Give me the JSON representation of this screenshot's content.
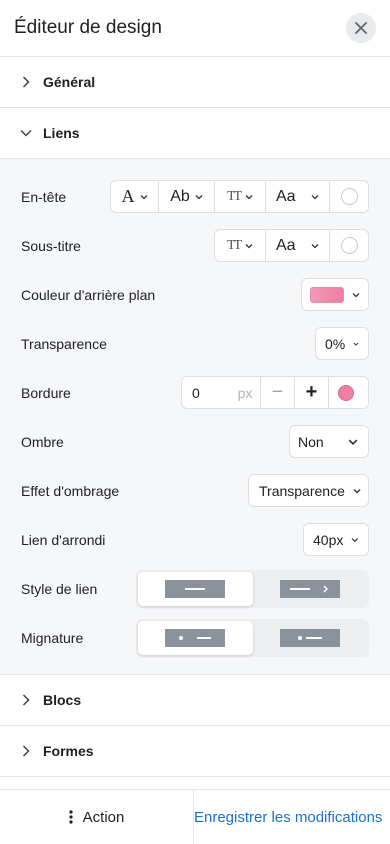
{
  "header": {
    "title": "Éditeur de design",
    "close_icon": "close-icon"
  },
  "sections": {
    "general": {
      "label": "Général",
      "expanded": false
    },
    "liens": {
      "label": "Liens",
      "expanded": true
    },
    "blocs": {
      "label": "Blocs",
      "expanded": false
    },
    "formes": {
      "label": "Formes",
      "expanded": false
    }
  },
  "liens": {
    "entete": {
      "label": "En-tête",
      "font_glyph": "A",
      "weight_glyph": "Ab",
      "size_glyph": "TT",
      "case_glyph": "Aa"
    },
    "sous_titre": {
      "label": "Sous-titre",
      "size_glyph": "TT",
      "case_glyph": "Aa"
    },
    "couleur": {
      "label": "Couleur d'arrière plan",
      "value_color": "#f28aab"
    },
    "transparence": {
      "label": "Transparence",
      "value": "0%"
    },
    "bordure": {
      "label": "Bordure",
      "value": "0",
      "unit": "px",
      "minus": "−",
      "plus": "+",
      "color": "#ef7fa3"
    },
    "ombre": {
      "label": "Ombre",
      "value": "Non"
    },
    "ombrage": {
      "label": "Effet d'ombrage",
      "value": "Transparence"
    },
    "arrondi": {
      "label": "Lien d'arrondi",
      "value": "40px"
    },
    "style": {
      "label": "Style de lien",
      "selected": 0
    },
    "mignature": {
      "label": "Mignature",
      "selected": 0
    }
  },
  "footer": {
    "action_label": "Action",
    "save_label": "Enregistrer les modifications"
  },
  "colors": {
    "accent": "#1a73c9",
    "pill": "#8a939c",
    "pink": "#ef7fa3"
  }
}
